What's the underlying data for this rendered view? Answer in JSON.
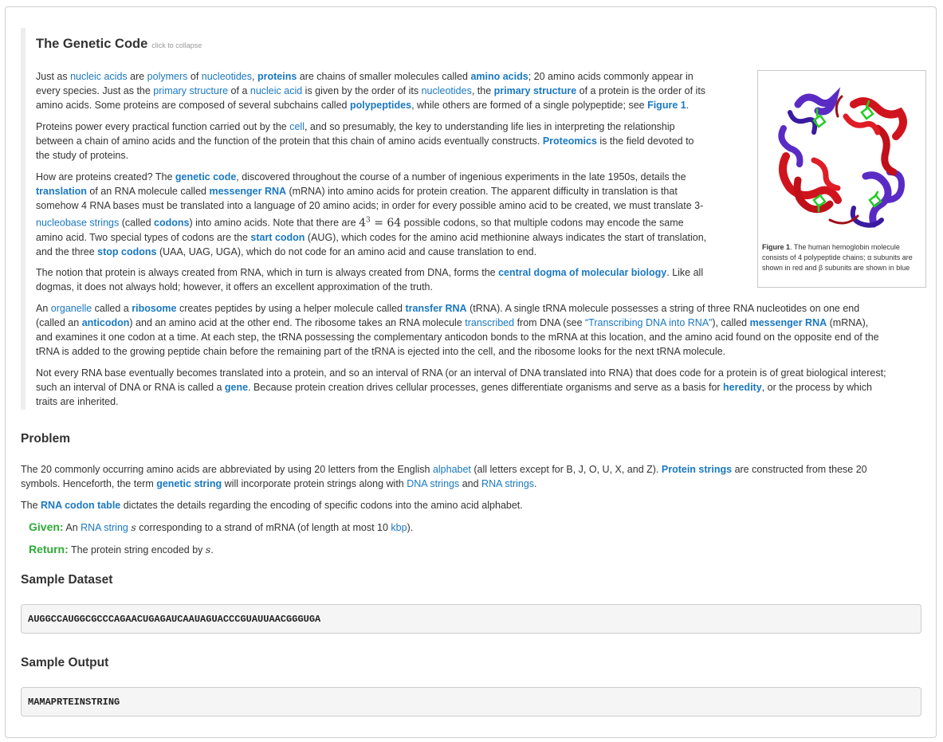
{
  "intro": {
    "title": "The Genetic Code",
    "collapse_hint": "click to collapse",
    "p1": {
      "t1": "Just as ",
      "l_nucleic_acids": "nucleic acids",
      "t2": " are ",
      "l_polymers": "polymers",
      "t3": " of ",
      "l_nucleotides": "nucleotides",
      "t4": ", ",
      "b_proteins": "proteins",
      "t5": " are chains of smaller molecules called ",
      "b_amino_acids": "amino acids",
      "t6": "; 20 amino acids commonly appear in",
      "line2_t1": "every species. Just as the ",
      "l_primary_structure": "primary structure",
      "line2_t2": " of a ",
      "l_nucleic_acid": "nucleic acid",
      "line2_t3": " is given by the order of its ",
      "l_nucleotides2": "nucleotides",
      "line2_t4": ", the ",
      "b_primary_structure": "primary structure",
      "line2_t5": " of a protein is the order of its",
      "line3_t1": "amino acids. Some proteins are composed of several subchains called ",
      "b_polypeptides": "polypeptides",
      "line3_t2": ", while others are formed of a single polypeptide; see ",
      "b_figure1": "Figure 1",
      "line3_t3": "."
    },
    "p2": {
      "t1": "Proteins power every practical function carried out by the ",
      "l_cell": "cell",
      "t2": ", and so presumably, the key to understanding life lies in interpreting the relationship",
      "line2": "between a chain of amino acids and the function of the protein that this chain of amino acids eventually constructs. ",
      "b_proteomics": "Proteomics",
      "line2_t2": " is the field devoted to",
      "line3": "the study of proteins."
    },
    "p3": {
      "t1": "How are proteins created? The ",
      "b_genetic_code": "genetic code",
      "t2": ", discovered throughout the course of a number of ingenious experiments in the late 1950s, details the",
      "b_translation": "translation",
      "t3": " of an RNA molecule called ",
      "b_messenger_rna": "messenger RNA",
      "t4": " (mRNA) into amino acids for protein creation. The apparent difficulty in translation is that",
      "line3": "somehow 4 RNA bases must be translated into a language of 20 amino acids; in order for every possible amino acid to be created, we must translate 3-",
      "l_nucleobase_strings": "nucleobase strings",
      "t5": " (called ",
      "b_codons": "codons",
      "t6": ") into amino acids. Note that there are ",
      "math_base": "4",
      "math_exp": "3",
      "math_rest": " = 64",
      "t7": " possible codons, so that multiple codons may encode the same",
      "line5_t1": "amino acid. Two special types of codons are the ",
      "b_start_codon": "start codon",
      "line5_t2": " (AUG), which codes for the amino acid methionine always indicates the start of translation,",
      "line6_t1": "and the three ",
      "b_stop_codons": "stop codons",
      "line6_t2": " (UAA, UAG, UGA), which do not code for an amino acid and cause translation to end."
    },
    "p4": {
      "t1": "The notion that protein is always created from RNA, which in turn is always created from DNA, forms the ",
      "b_central_dogma": "central dogma of molecular biology",
      "t2": ". Like all",
      "line2": "dogmas, it does not always hold; however, it offers an excellent approximation of the truth."
    },
    "p5": {
      "t1": "An ",
      "l_organelle": "organelle",
      "t2": " called a ",
      "b_ribosome": "ribosome",
      "t3": " creates peptides by using a helper molecule called ",
      "b_transfer_rna": "transfer RNA",
      "t4": " (tRNA). A single tRNA molecule possesses a string of three RNA nucleotides on one end",
      "line2_t1": "(called an ",
      "b_anticodon": "anticodon",
      "line2_t2": ") and an amino acid at the other end. The ribosome takes an RNA molecule ",
      "l_transcribed": "transcribed",
      "line2_t3": " from DNA (see ",
      "l_transcribing": "“Transcribing DNA into RNA”",
      "line2_t4": "), called ",
      "b_messenger_rna2": "messenger RNA",
      "line2_t5": " (mRNA),",
      "line3": "and examines it one codon at a time. At each step, the tRNA possessing the complementary anticodon bonds to the mRNA at this location, and the amino acid found on the opposite end of the",
      "line4": "tRNA is added to the growing peptide chain before the remaining part of the tRNA is ejected into the cell, and the ribosome looks for the next tRNA molecule."
    },
    "p6": {
      "line1": "Not every RNA base eventually becomes translated into a protein, and so an interval of RNA (or an interval of DNA translated into RNA) that does code for a protein is of great biological interest;",
      "line2_t1": "such an interval of DNA or RNA is called a ",
      "b_gene": "gene",
      "line2_t2": ". Because protein creation drives cellular processes, genes differentiate organisms and serve as a basis for ",
      "b_heredity": "heredity",
      "line2_t3": ", or the process by which",
      "line3": "traits are inherited."
    },
    "figure": {
      "caption_bold": "Figure 1",
      "caption_text": ". The human hemoglobin molecule consists of 4 polypeptide chains; α subunits are shown in red and β subunits are shown in blue"
    }
  },
  "problem": {
    "heading": "Problem",
    "p1_t1": "The 20 commonly occurring amino acids are abbreviated by using 20 letters from the English ",
    "l_alphabet": "alphabet",
    "p1_t2": " (all letters except for B, J, O, U, X, and Z). ",
    "b_protein_strings": "Protein strings",
    "p1_t3": " are constructed from these 20",
    "p1_line2_t1": "symbols. Henceforth, the term ",
    "b_genetic_string": "genetic string",
    "p1_line2_t2": " will incorporate protein strings along with ",
    "l_dna_strings": "DNA strings",
    "p1_line2_t3": " and ",
    "l_rna_strings": "RNA strings",
    "p1_line2_t4": ".",
    "p2_t1": "The ",
    "b_rna_codon_table": "RNA codon table",
    "p2_t2": " dictates the details regarding the encoding of specific codons into the amino acid alphabet.",
    "given_label": "Given:",
    "given_t1": " An ",
    "l_rna_string": "RNA string",
    "given_var": "s",
    "given_t2": " corresponding to a strand of mRNA (of length at most 10 ",
    "l_kbp": "kbp",
    "given_t3": ").",
    "return_label": "Return:",
    "return_t1": " The protein string encoded by ",
    "return_var": "s",
    "return_t2": "."
  },
  "sample_dataset": {
    "heading": "Sample Dataset",
    "value": "AUGGCCAUGGCGCCCAGAACUGAGAUCAAUAGUACCCGUAUUAACGGGUGA"
  },
  "sample_output": {
    "heading": "Sample Output",
    "value": "MAMAPRTEINSTRING"
  },
  "colors": {
    "link": "#1a78c2",
    "given": "#2eab37",
    "alpha_subunit": "#d0141d",
    "beta_subunit": "#5a2bc4",
    "heme": "#22cc22"
  },
  "icons": {
    "figure": "hemoglobin-molecule-image"
  }
}
